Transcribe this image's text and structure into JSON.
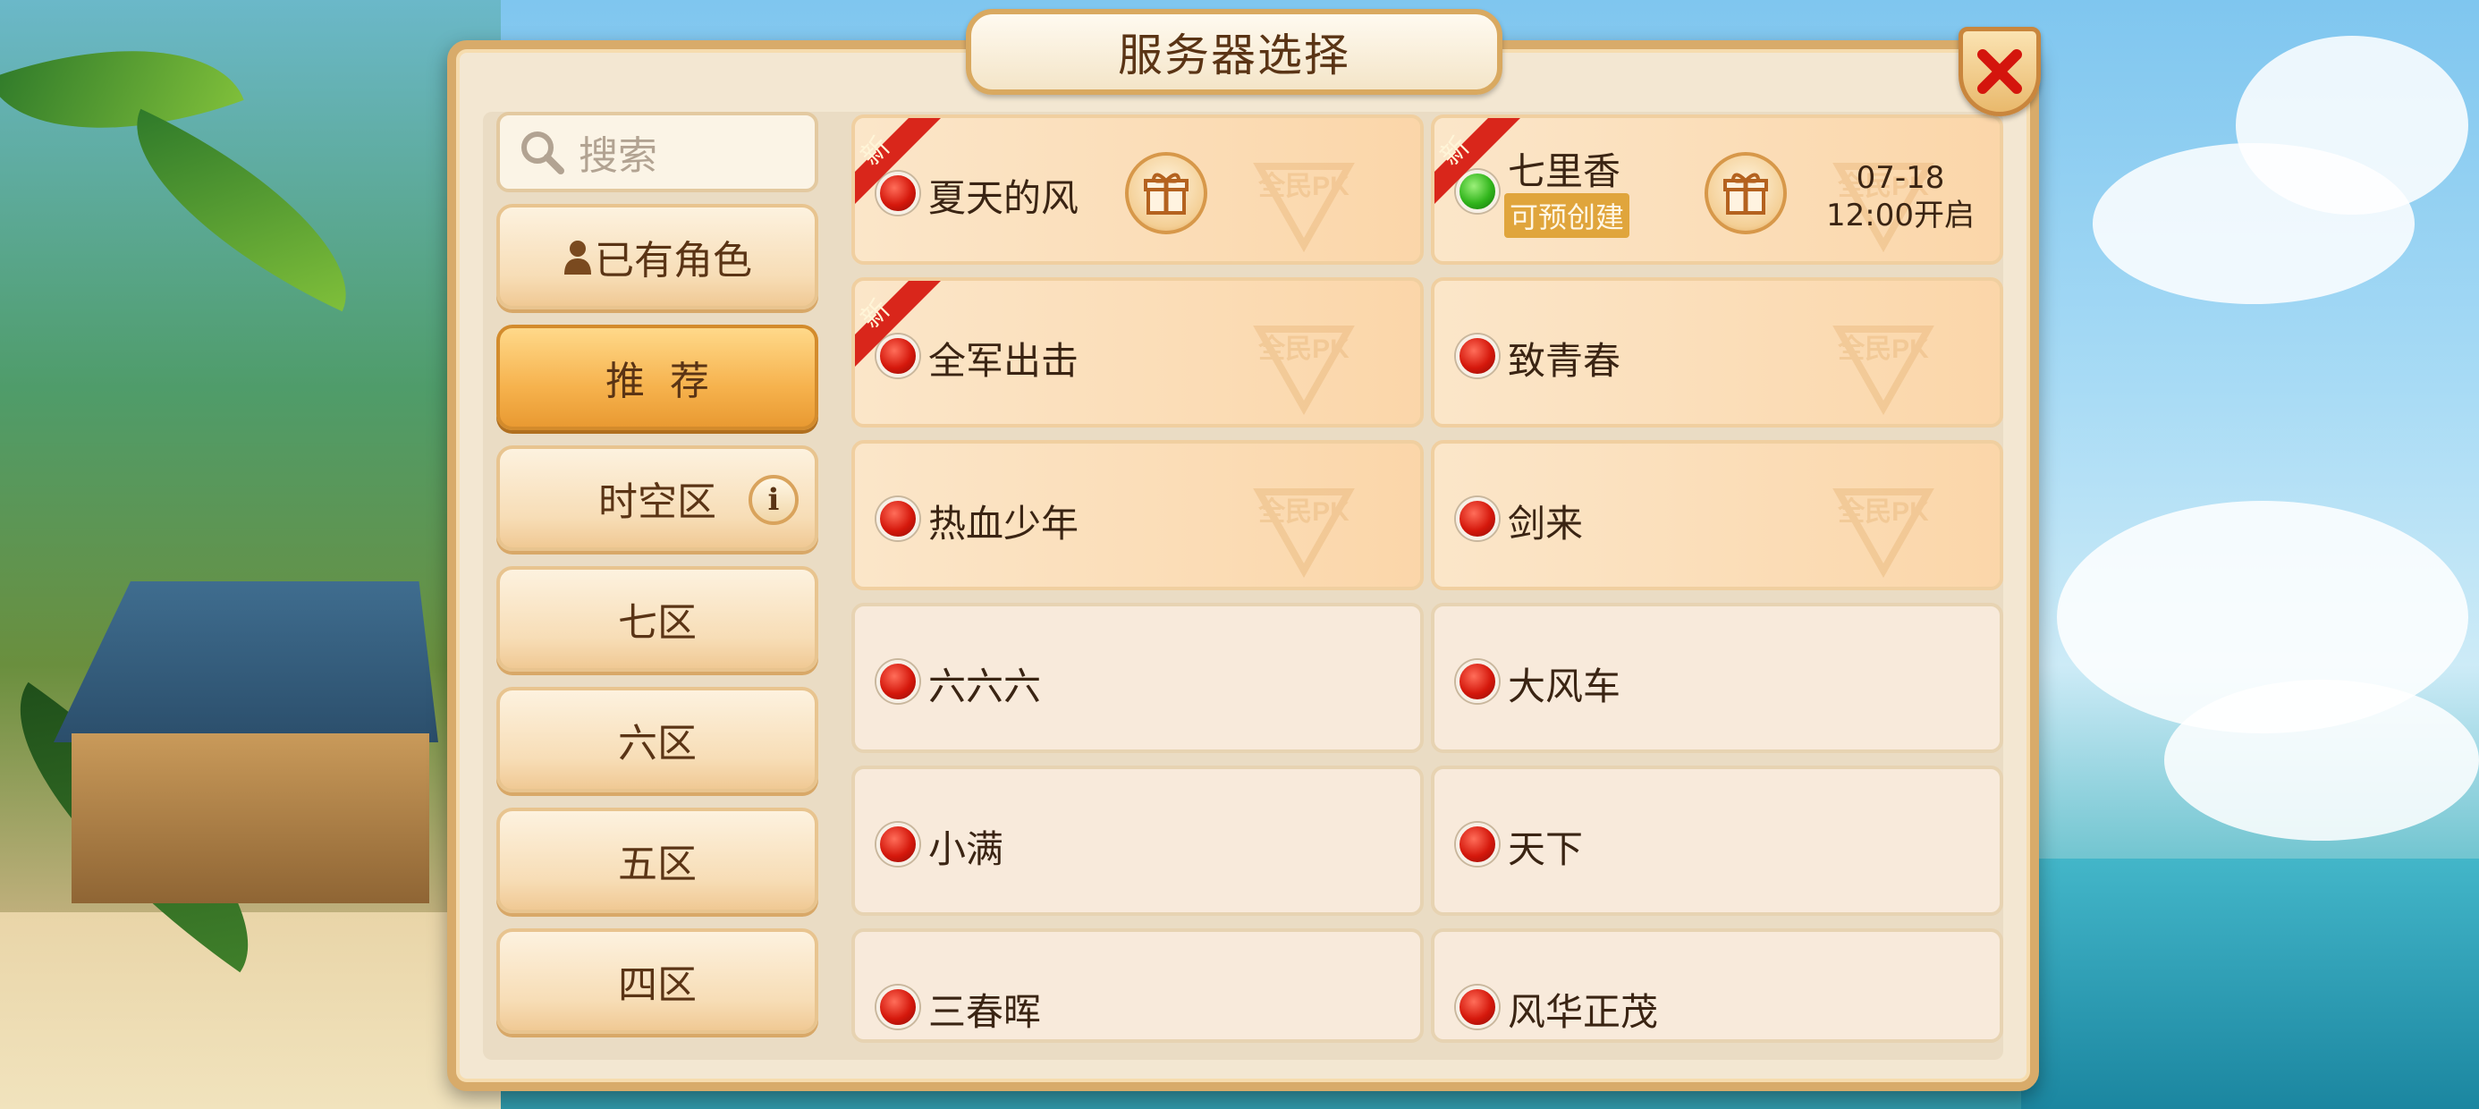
{
  "title": "服务器选择",
  "close_icon": "close-x-icon",
  "search": {
    "icon": "search-icon",
    "placeholder": "搜索"
  },
  "categories": [
    {
      "label": "已有角色",
      "icon": "person-icon",
      "active": false
    },
    {
      "label": "推荐",
      "active": true
    },
    {
      "label": "时空区",
      "icon": "info-icon",
      "active": false
    },
    {
      "label": "七区",
      "active": false
    },
    {
      "label": "六区",
      "active": false
    },
    {
      "label": "五区",
      "active": false
    },
    {
      "label": "四区",
      "active": false
    }
  ],
  "ribbon_text": "新",
  "watermark_text": "全民PK",
  "servers": [
    {
      "name": "夏天的风",
      "status": "red",
      "new": true,
      "gift": true,
      "style": "recommend"
    },
    {
      "name": "七里香",
      "status": "green",
      "new": true,
      "gift": true,
      "style": "recommend",
      "tag": "可预创建",
      "open_date": "07-18",
      "open_time": "12:00开启"
    },
    {
      "name": "全军出击",
      "status": "red",
      "new": true,
      "style": "recommend"
    },
    {
      "name": "致青春",
      "status": "red",
      "style": "recommend"
    },
    {
      "name": "热血少年",
      "status": "red",
      "style": "recommend"
    },
    {
      "name": "剑来",
      "status": "red",
      "style": "recommend"
    },
    {
      "name": "六六六",
      "status": "red",
      "style": "normal"
    },
    {
      "name": "大风车",
      "status": "red",
      "style": "normal"
    },
    {
      "name": "小满",
      "status": "red",
      "style": "normal"
    },
    {
      "name": "天下",
      "status": "red",
      "style": "normal"
    },
    {
      "name": "三春晖",
      "status": "red",
      "style": "normal"
    },
    {
      "name": "风华正茂",
      "status": "red",
      "style": "normal"
    }
  ],
  "colors": {
    "panel_border": "#d8ab6a",
    "active_tab": "#f6b24d",
    "status_red": "#d5180c",
    "status_green": "#31b51c",
    "tag_bg": "#e0a53c"
  }
}
